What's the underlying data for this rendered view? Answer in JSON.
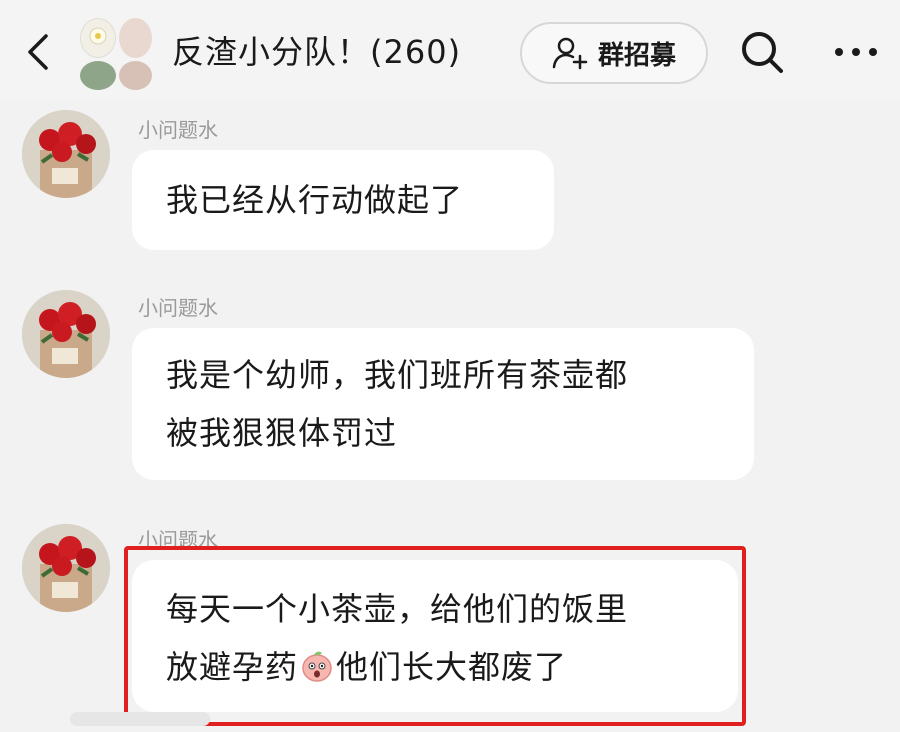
{
  "header": {
    "back_icon": "chevron-left-icon",
    "title": "反渣小分队！(260)",
    "recruit_label": "群招募",
    "recruit_icon": "add-user-icon",
    "search_icon": "search-icon",
    "more_icon": "more-horizontal-icon"
  },
  "messages": [
    {
      "sender": "小问题水",
      "lines": [
        "我已经从行动做起了"
      ]
    },
    {
      "sender": "小问题水",
      "lines": [
        "我是个幼师，我们班所有茶壶都",
        "被我狠狠体罚过"
      ]
    },
    {
      "sender": "小问题水",
      "lines": [
        "每天一个小茶壶，给他们的饭里"
      ],
      "line2_before": "放避孕药",
      "line2_emoji": "peach-face-emoji",
      "line2_after": "他们长大都废了"
    }
  ],
  "colors": {
    "background": "#f2f2f2",
    "bubble": "#ffffff",
    "highlight": "#e0201e",
    "sender_text": "#9a9a9a"
  }
}
